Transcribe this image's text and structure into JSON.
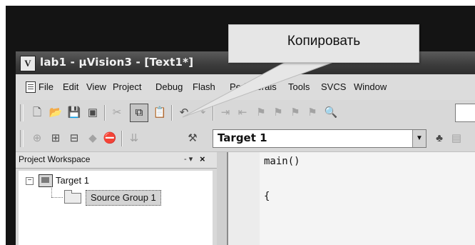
{
  "window": {
    "title": "lab1  - µVision3 - [Text1*]"
  },
  "callout": {
    "text": "Копировать"
  },
  "menu": {
    "items": [
      "File",
      "Edit",
      "View",
      "Project",
      "Debug",
      "Flash",
      "Peripherals",
      "Tools",
      "SVCS",
      "Window"
    ]
  },
  "toolbar": {
    "target_value": "Target 1"
  },
  "workspace": {
    "title": "Project Workspace",
    "pin_glyph": "- ▾",
    "close_glyph": "×",
    "tree": {
      "target": "Target 1",
      "group": "Source Group 1"
    }
  },
  "editor": {
    "lines": [
      "main()",
      "{"
    ]
  },
  "icons": {
    "new": "new-file-icon",
    "open": "open-folder-icon",
    "save": "save-icon",
    "save_all": "save-all-icon",
    "cut": "cut-icon",
    "copy": "copy-icon",
    "paste": "paste-icon",
    "undo": "undo-icon",
    "redo": "redo-icon",
    "indent": "indent-icon",
    "unindent": "unindent-icon",
    "bookmark": "bookmark-icon",
    "find": "find-icon",
    "compile": "compile-icon",
    "build": "build-icon",
    "rebuild": "rebuild-icon",
    "batch": "batch-build-icon",
    "stop": "stop-build-icon",
    "download": "download-icon",
    "options": "target-options-icon",
    "manage": "manage-components-icon"
  }
}
